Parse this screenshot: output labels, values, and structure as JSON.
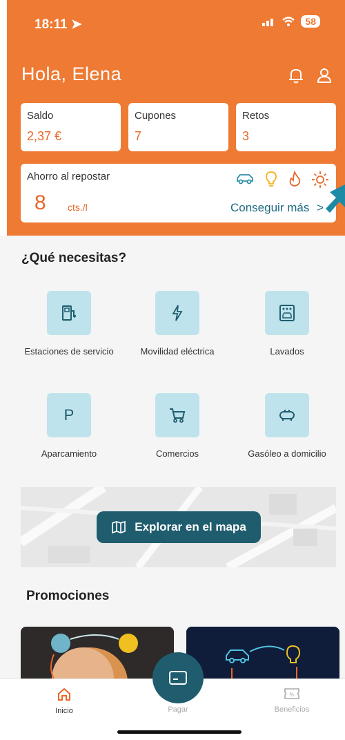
{
  "status_bar": {
    "time": "18:11",
    "battery": "58"
  },
  "header": {
    "greeting": "Hola, Elena"
  },
  "summary": [
    {
      "label": "Saldo",
      "value": "2,37 €"
    },
    {
      "label": "Cupones",
      "value": "7"
    },
    {
      "label": "Retos",
      "value": "3"
    }
  ],
  "savings": {
    "label": "Ahorro al repostar",
    "value": "8",
    "unit": "cts./l",
    "more": "Conseguir más"
  },
  "needs": {
    "title": "¿Qué necesitas?",
    "items": [
      {
        "label": "Estaciones de servicio",
        "icon": "fuel-pump-icon"
      },
      {
        "label": "Movilidad eléctrica",
        "icon": "lightning-icon"
      },
      {
        "label": "Lavados",
        "icon": "car-wash-icon"
      },
      {
        "label": "Aparcamiento",
        "icon": "parking-icon"
      },
      {
        "label": "Comercios",
        "icon": "cart-icon"
      },
      {
        "label": "Gasóleo a domicilio",
        "icon": "fuel-tank-icon"
      }
    ]
  },
  "map": {
    "button": "Explorar en el mapa"
  },
  "promotions": {
    "title": "Promociones"
  },
  "tabs": {
    "home": "Inicio",
    "pay": "Pagar",
    "benefits": "Beneficios"
  },
  "colors": {
    "brand_orange": "#ee7a33",
    "accent_teal": "#1f5d6e",
    "tile_blue": "#bfe3ec",
    "value_orange": "#e8682a"
  }
}
